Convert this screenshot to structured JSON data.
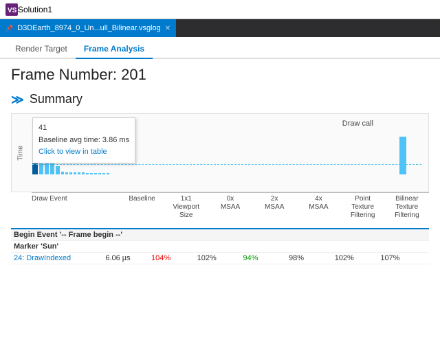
{
  "titleBar": {
    "logo": "VS",
    "title": "Solution1"
  },
  "tabBar": {
    "tab": {
      "label": "D3DEarth_8974_0_Un...ull_Bilinear.vsglog",
      "pinIcon": "📌",
      "closeIcon": "✕"
    }
  },
  "subTabs": [
    {
      "label": "Render Target",
      "active": false
    },
    {
      "label": "Frame Analysis",
      "active": true
    }
  ],
  "content": {
    "frameNumber": "Frame Number: 201",
    "sectionChevron": "≫",
    "sectionTitle": "Summary",
    "chart": {
      "yAxisLabel": "Time",
      "drawCallLabel": "Draw call",
      "tooltip": {
        "line1": "41",
        "line2": "Baseline avg time: 3.86 ms",
        "line3": "Click to view in table"
      },
      "dashedLinePercent": 15
    },
    "xLabels": [
      {
        "text": "Draw Event",
        "flex": 2
      },
      {
        "text": "Baseline",
        "flex": 1
      },
      {
        "text": "1x1\nViewport\nSize",
        "flex": 1
      },
      {
        "text": "0x\nMSAA",
        "flex": 1
      },
      {
        "text": "2x\nMSAA",
        "flex": 1
      },
      {
        "text": "4x\nMSAA",
        "flex": 1
      },
      {
        "text": "Point\nTexture\nFiltering",
        "flex": 1
      },
      {
        "text": "Bilinear\nTexture\nFiltering",
        "flex": 1
      }
    ],
    "tableHeaders": [
      "Draw Event",
      "Baseline",
      "1x1 Viewport Size",
      "0x MSAA",
      "2x MSAA",
      "4x MSAA",
      "Point Texture Filtering",
      "Bilinear Texture Filtering"
    ],
    "tableRows": [
      {
        "type": "group",
        "label": "Begin Event '-- Frame begin --'"
      },
      {
        "type": "marker",
        "label": "Marker 'Sun'"
      },
      {
        "type": "data",
        "event": "24: DrawIndexed",
        "baseline": "6.06 µs",
        "v1x1": "104%",
        "v0xmsaa": "102%",
        "v2xmsaa": "94%",
        "v4xmsaa": "98%",
        "vpoint": "102%",
        "vbilinear": "107%",
        "baselineColor": "blue",
        "v1x1Color": "red",
        "v2xmsaaColor": "green"
      }
    ]
  }
}
